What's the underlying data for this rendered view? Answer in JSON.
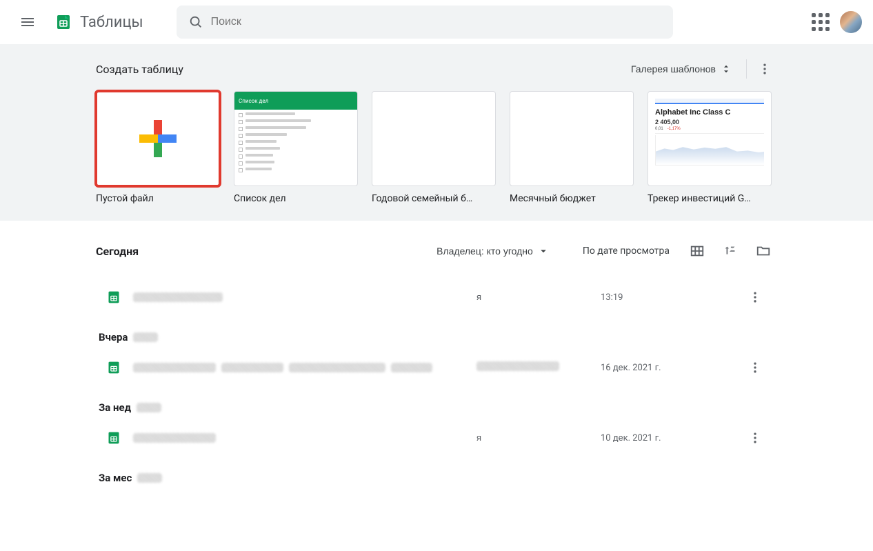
{
  "header": {
    "app_title": "Таблицы",
    "search_placeholder": "Поиск"
  },
  "templates": {
    "section_title": "Создать таблицу",
    "gallery_label": "Галерея шаблонов",
    "items": [
      {
        "label": "Пустой файл",
        "highlight": true,
        "kind": "blank"
      },
      {
        "label": "Список дел",
        "highlight": false,
        "kind": "todo",
        "thumb_title": "Список дел"
      },
      {
        "label": "Годовой семейный б…",
        "highlight": false,
        "kind": "blank_sheet"
      },
      {
        "label": "Месячный бюджет",
        "highlight": false,
        "kind": "blank_sheet"
      },
      {
        "label": "Трекер инвестиций G…",
        "highlight": false,
        "kind": "invest",
        "thumb_title": "Alphabet Inc Class C",
        "thumb_value": "2 405,00",
        "thumb_meta": [
          "0,01",
          "-1,17%"
        ]
      }
    ]
  },
  "filesHeader": {
    "owner_filter_label": "Владелец: кто угодно",
    "sort_label": "По дате просмотра"
  },
  "groups": [
    {
      "title": "Сегодня",
      "smudge": false,
      "items": [
        {
          "owner": "я",
          "date": "13:19",
          "name_widths": [
            130
          ]
        }
      ]
    },
    {
      "title": "Вчера",
      "smudge": true,
      "items": [
        {
          "owner": "",
          "owner_smudge": 120,
          "date": "16 дек. 2021 г.",
          "name_widths": [
            120,
            90,
            140,
            60
          ]
        }
      ]
    },
    {
      "title": "За нед",
      "smudge": true,
      "items": [
        {
          "owner": "я",
          "date": "10 дек. 2021 г.",
          "name_widths": [
            120
          ]
        }
      ]
    },
    {
      "title": "За мес",
      "smudge": true,
      "items": []
    }
  ]
}
